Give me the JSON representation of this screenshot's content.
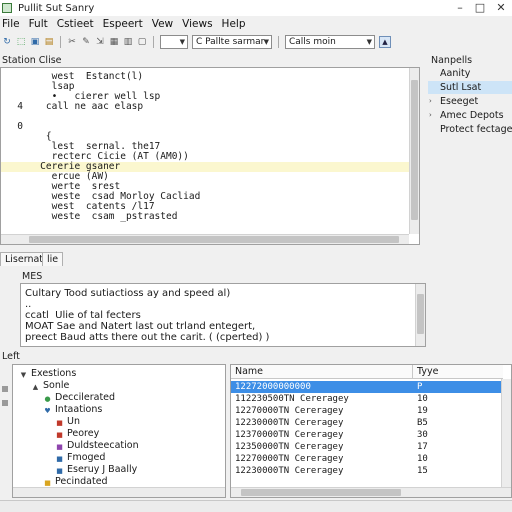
{
  "window": {
    "title": "Pullit Sut Sanry"
  },
  "menu": [
    "File",
    "Fult",
    "Cstieet",
    "Espeert",
    "Vew",
    "Views",
    "Help"
  ],
  "toolbar": {
    "combo_small": "",
    "combo1": "C Pallte sarmar",
    "combo2": "Calls moin"
  },
  "editor": {
    "header": "Station Clise",
    "lines": [
      {
        "num": "",
        "text": "     west  Estanct(l)",
        "hl": false
      },
      {
        "num": "",
        "text": "     lsap",
        "hl": false
      },
      {
        "num": "",
        "text": "     •   cierer well lsp",
        "hl": false
      },
      {
        "num": "4",
        "text": "    call ne aac elasp",
        "hl": false
      },
      {
        "num": "",
        "text": "",
        "hl": false
      },
      {
        "num": "0",
        "text": "",
        "hl": false
      },
      {
        "num": "",
        "text": "    {",
        "hl": false
      },
      {
        "num": "",
        "text": "     lest  sernal. the17",
        "hl": false
      },
      {
        "num": "",
        "text": "     recterc Cicie (AT (AM0))",
        "hl": false
      },
      {
        "num": "",
        "text": "   Cererie gsaner",
        "hl": true
      },
      {
        "num": "",
        "text": "     ercue (AW)",
        "hl": false
      },
      {
        "num": "",
        "text": "     werte  srest",
        "hl": false
      },
      {
        "num": "",
        "text": "     weste  csad Morloy Cacliad",
        "hl": false
      },
      {
        "num": "",
        "text": "     west  catents /l17",
        "hl": false
      },
      {
        "num": "",
        "text": "     weste  csam _pstrasted",
        "hl": false
      }
    ]
  },
  "navigator": {
    "header": "Nanpells",
    "items": [
      {
        "label": "Aanity",
        "expander": "",
        "selected": false
      },
      {
        "label": "Sutl Lsat",
        "expander": "",
        "selected": true
      },
      {
        "label": "Eseeget",
        "expander": "›",
        "selected": false
      },
      {
        "label": "Amec Depots",
        "expander": "›",
        "selected": false
      },
      {
        "label": "Protect fectagec",
        "expander": "",
        "selected": false
      }
    ]
  },
  "tabs": [
    "Lisernation",
    "lie"
  ],
  "output": {
    "label": "MES",
    "lines": [
      "Cultary Tood sutiactioss ay and speed al)",
      "..",
      "ccatl  Ulie of tal fecters",
      "MOAT Sae and Natert last out trland entegert,",
      "preect Baud atts there out the carit. ( (cperted) )"
    ]
  },
  "lower_head": "Left",
  "tree": {
    "nodes": [
      {
        "label": "Exestions",
        "depth": 0,
        "icon": "▼",
        "color": "#444444"
      },
      {
        "label": "Sonle",
        "depth": 1,
        "icon": "▲",
        "color": "#444444"
      },
      {
        "label": "Deccilerated",
        "depth": 2,
        "icon": "●",
        "color": "#3a9a4a"
      },
      {
        "label": "Intaations",
        "depth": 2,
        "icon": "♥",
        "color": "#2f6aa8"
      },
      {
        "label": "Un",
        "depth": 3,
        "icon": "■",
        "color": "#c0392b"
      },
      {
        "label": "Peorey",
        "depth": 3,
        "icon": "■",
        "color": "#c0392b"
      },
      {
        "label": "Duldsteecation",
        "depth": 3,
        "icon": "■",
        "color": "#8e44ad"
      },
      {
        "label": "Fmoged",
        "depth": 3,
        "icon": "■",
        "color": "#2f6aa8"
      },
      {
        "label": "Eseruy J Baally",
        "depth": 3,
        "icon": "■",
        "color": "#2f6aa8"
      },
      {
        "label": "Pecindated",
        "depth": 2,
        "icon": "■",
        "color": "#d9a520"
      }
    ]
  },
  "table": {
    "columns": [
      "Name",
      "Tyye"
    ],
    "rows": [
      {
        "name": "12272000000000",
        "type": "P",
        "selected": true
      },
      {
        "name": "112230500TN Cereragey",
        "type": "10",
        "selected": false
      },
      {
        "name": "12270000TN Cereragey",
        "type": "19",
        "selected": false
      },
      {
        "name": "12230000TN Cereragey",
        "type": "B5",
        "selected": false
      },
      {
        "name": "12370000TN Cereragey",
        "type": "30",
        "selected": false
      },
      {
        "name": "12350000TN Cereragey",
        "type": "17",
        "selected": false
      },
      {
        "name": "12270000TN Cereragey",
        "type": "10",
        "selected": false
      },
      {
        "name": "12230000TN Cereragey",
        "type": "15",
        "selected": false
      }
    ]
  }
}
